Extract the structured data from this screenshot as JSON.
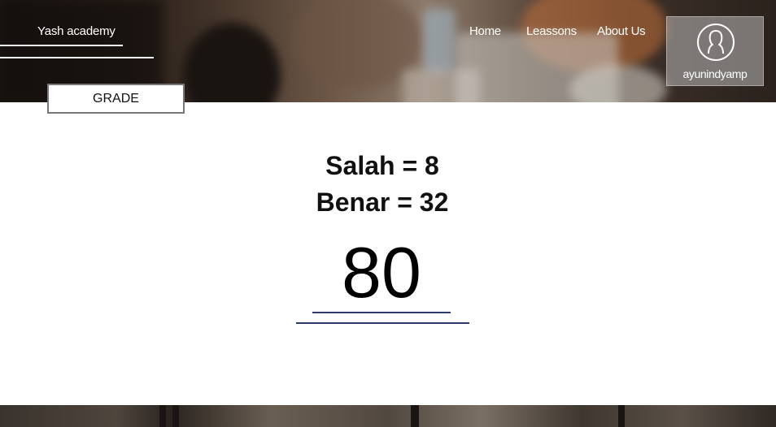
{
  "header": {
    "brand": "Yash academy",
    "nav": {
      "home": "Home",
      "lessons": "Leassons",
      "about": "About Us"
    },
    "profile": {
      "icon": "user-avatar-icon",
      "username": "ayunindyamp"
    }
  },
  "tab": {
    "label": "GRADE"
  },
  "result": {
    "wrong_label": "Salah = 8",
    "correct_label": "Benar = 32",
    "score": "80"
  },
  "colors": {
    "accent_line": "#2b3a6b",
    "text": "#111111",
    "nav_text": "#ffffff"
  }
}
